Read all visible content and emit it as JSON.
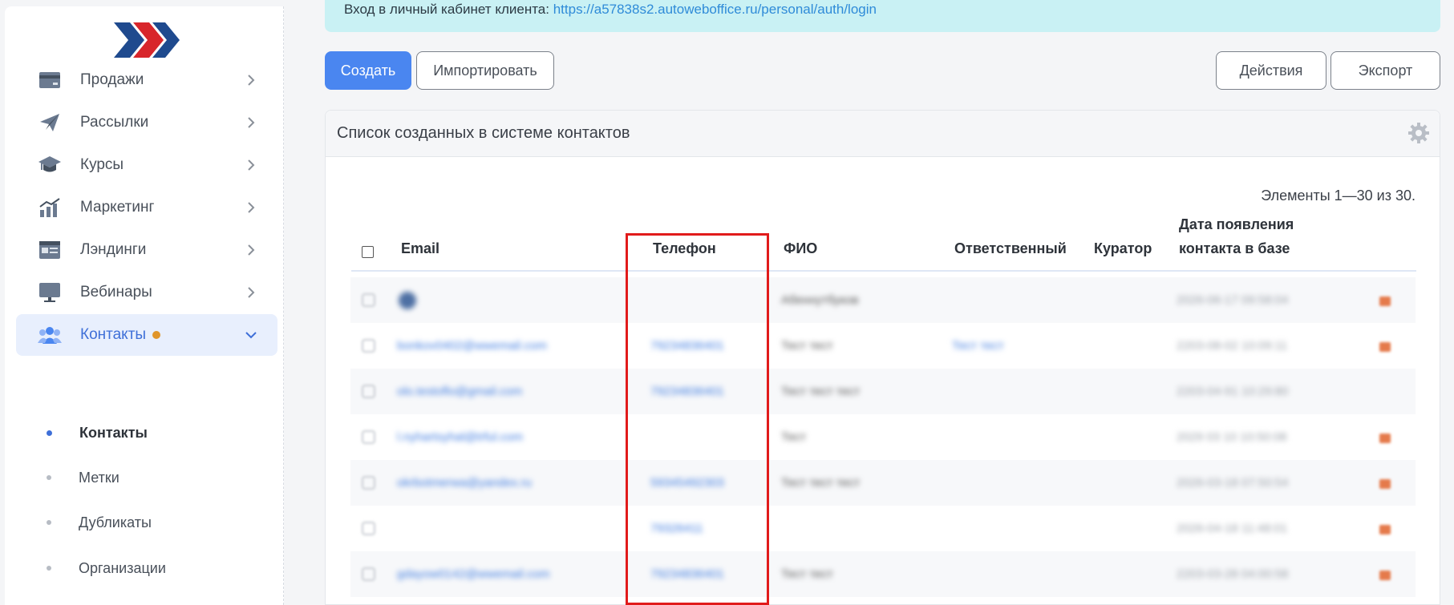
{
  "colors": {
    "accent": "#4a86f0",
    "active_bg": "#e8effd",
    "highlight": "#e11b1b",
    "banner": "#c9f1f4",
    "badge": "#e0952a"
  },
  "banner": {
    "text": "Вход в личный кабинет клиента:",
    "url": "https://a57838s2.autoweboffice.ru/personal/auth/login"
  },
  "sidebar": {
    "items": [
      {
        "label": "Продажи",
        "icon": "card-icon"
      },
      {
        "label": "Рассылки",
        "icon": "paper-plane-icon"
      },
      {
        "label": "Курсы",
        "icon": "graduation-cap-icon"
      },
      {
        "label": "Маркетинг",
        "icon": "chart-growth-icon"
      },
      {
        "label": "Лэндинги",
        "icon": "landing-page-icon"
      },
      {
        "label": "Вебинары",
        "icon": "monitor-icon"
      },
      {
        "label": "Контакты",
        "icon": "users-icon",
        "active": true
      }
    ],
    "sub_items": [
      {
        "label": "Контакты",
        "active": true
      },
      {
        "label": "Метки"
      },
      {
        "label": "Дубликаты"
      },
      {
        "label": "Организации"
      }
    ]
  },
  "toolbar": {
    "create": "Создать",
    "import": "Импортировать",
    "actions": "Действия",
    "export": "Экспорт"
  },
  "panel": {
    "title": "Список созданных в системе контактов",
    "count": "Элементы 1—30 из 30."
  },
  "table": {
    "columns": {
      "email": "Email",
      "phone": "Телефон",
      "fio": "ФИО",
      "responsible": "Ответственный",
      "curator": "Куратор",
      "date_line1": "Дата появления",
      "date_line2": "контакта в базе"
    },
    "rows": [
      {
        "email": "",
        "phone": "",
        "fio": "Абеннутбуков",
        "responsible": "",
        "date": "2026-06-17 09:58:04"
      },
      {
        "email": "bonkov0402@wwemail.com",
        "phone": "79234836401",
        "fio": "Тест тест",
        "responsible": "Тест тест",
        "date": "2203-08-02 10:09:11"
      },
      {
        "email": "olo.testoflo@gmail.com",
        "phone": "79234836401",
        "fio": "Тест тест тест",
        "responsible": "",
        "date": "2203-04-91 10:29:80"
      },
      {
        "email": "l.nyhartsyhal@trful.com",
        "phone": "",
        "fio": "Тест",
        "responsible": "",
        "date": "2029 03 10 10:50:08"
      },
      {
        "email": "okrbotmerwa@yandex.ru",
        "phone": "59345492303",
        "fio": "Тест тест тест",
        "responsible": "",
        "date": "2026-03-18 07:50:54"
      },
      {
        "email": "",
        "phone": "79326411",
        "fio": "",
        "responsible": "",
        "date": "2026-04-18 11:48:01"
      },
      {
        "email": "gdayow0142@wwemail.com",
        "phone": "79234836401",
        "fio": "Тест тест",
        "responsible": "",
        "date": "2203-03-28 04:00:58"
      }
    ]
  }
}
